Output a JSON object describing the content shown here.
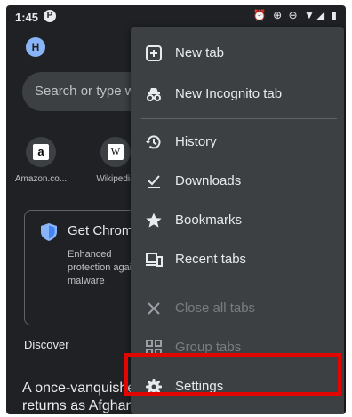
{
  "status_bar": {
    "time": "1:45",
    "app_icon_letter": "P",
    "right_icons": "⏰ ⊕ ⊖ ▼◢ ▮"
  },
  "profile": {
    "initial": "H"
  },
  "search": {
    "placeholder": "Search or type web address"
  },
  "shortcuts": [
    {
      "label": "Amazon.co...",
      "glyph": "a"
    },
    {
      "label": "Wikipedia",
      "glyph": "W"
    }
  ],
  "promo_card": {
    "title": "Get Chrome's strongest security",
    "description": "Enhanced protection against malware"
  },
  "feed": {
    "section_title": "Discover",
    "headline_line1": "A once-vanquished",
    "headline_line2": "returns as Afghanistan's likely"
  },
  "menu": {
    "items": [
      {
        "label": "New tab",
        "icon": "plus-box-icon",
        "enabled": true
      },
      {
        "label": "New Incognito tab",
        "icon": "incognito-icon",
        "enabled": true
      },
      {
        "label": "History",
        "icon": "history-icon",
        "enabled": true
      },
      {
        "label": "Downloads",
        "icon": "download-icon",
        "enabled": true
      },
      {
        "label": "Bookmarks",
        "icon": "star-icon",
        "enabled": true
      },
      {
        "label": "Recent tabs",
        "icon": "devices-icon",
        "enabled": true
      },
      {
        "label": "Close all tabs",
        "icon": "close-icon",
        "enabled": false
      },
      {
        "label": "Group tabs",
        "icon": "grid-icon",
        "enabled": false
      },
      {
        "label": "Settings",
        "icon": "gear-icon",
        "enabled": true
      }
    ]
  },
  "colors": {
    "background": "#202124",
    "menu_background": "#3c4043",
    "highlight": "#e10600",
    "text": "#e8eaed",
    "disabled_text": "#7a7d80"
  }
}
